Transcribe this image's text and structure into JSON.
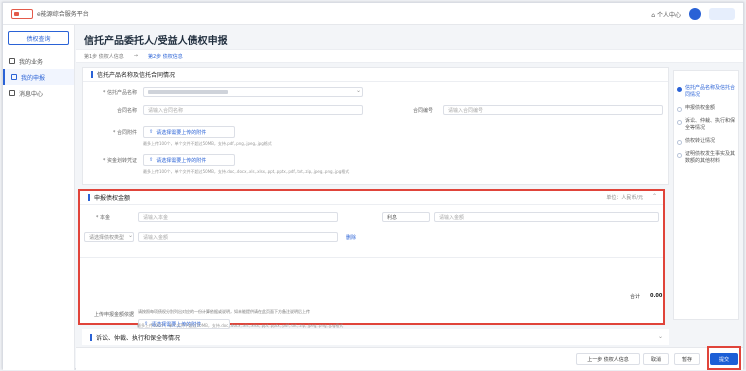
{
  "topbar": {
    "brand": "e能源综合服务平台",
    "personal_center": "个人中心"
  },
  "sidebar": {
    "primary_button": "债权查询",
    "items": [
      {
        "label": "我的业务"
      },
      {
        "label": "我的申报"
      },
      {
        "label": "消息中心"
      }
    ]
  },
  "page": {
    "title": "信托产品委托人/受益人债权申报"
  },
  "steps": {
    "step1": "第1步 债权人信息",
    "arrow": "→",
    "step2": "第2步 债权信息"
  },
  "section1": {
    "title": "信托产品名称及信托合同情况",
    "product_label": "* 信托产品名称",
    "contract_name_label": "合同名称",
    "contract_name_placeholder": "请输入合同名称",
    "contract_no_label": "合同编号",
    "contract_no_placeholder": "请输入合同编号",
    "contract_file_label": "* 合同附件",
    "upload_label": "请选择需要上传的附件",
    "upload_hint": "最多上传100个，单个文件不超过50MB，支持.pdf,.png,.jpeg,.jpg格式",
    "transfer_label": "* 资金划转凭证",
    "upload_label2": "请选择需要上传的附件",
    "upload_hint2": "最多上传100个，单个文件不超过50MB，支持.doc,.docx,.xls,.xlsx,.ppt,.pptx,.pdf,.txt,.zip,.jpeg,.png,.jpg格式"
  },
  "section2": {
    "title": "申报债权金额",
    "unit": "单位：人民币/元",
    "principal_label": "* 本金",
    "principal_placeholder": "请输入本金",
    "interest_label": "利息",
    "interest_placeholder": "请输入金额",
    "other_type_label": "请选择债权类型",
    "other_placeholder": "请输入金额",
    "delete_label": "删除",
    "total_label": "合计",
    "total_value": "0.00",
    "basis_label": "上传申报金额依据",
    "basis_note": "请按照每项债权分别列出对应的一份计算依据或说明，如未能提供请在此页面下方备注说明后上传",
    "upload_label": "请选择需要上传的附件",
    "upload_hint": "最多上传100个，单个文件不超过50MB，支持.doc,.docx,.xls,.xlsx,.ppt,.pptx,.pdf,.txt,.zip,.jpeg,.png,.jpg格式"
  },
  "section3": {
    "title": "诉讼、仲裁、执行和保全等情况"
  },
  "rightnav": {
    "items": [
      "信托产品名称及信托合同情况",
      "申报债权金额",
      "诉讼、仲裁、执行和保全等情况",
      "债权转让情况",
      "证明债权发生事实及其数额的其他材料"
    ]
  },
  "footer": {
    "prev": "上一步 债权人信息",
    "cancel": "取消",
    "save": "暂存",
    "submit": "提交"
  }
}
